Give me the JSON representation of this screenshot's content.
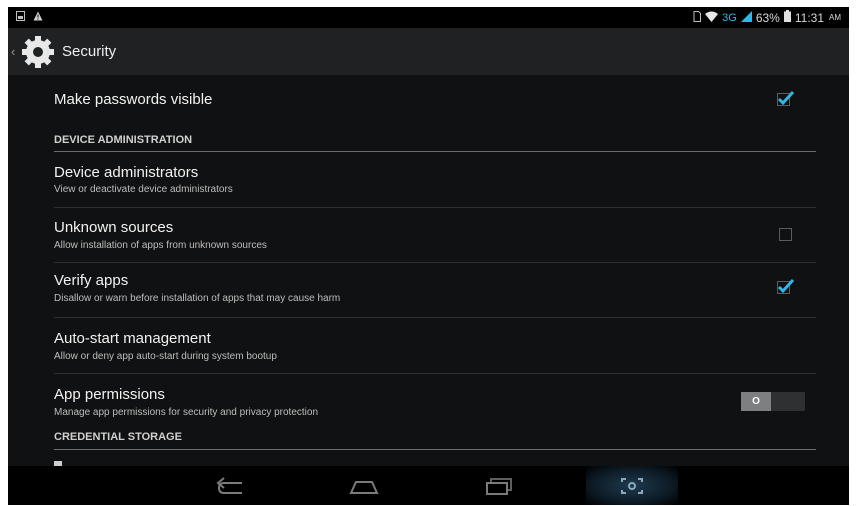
{
  "status_bar": {
    "network": "3G",
    "battery": "63%",
    "time": "11:31",
    "ampm": "AM"
  },
  "action_bar": {
    "title": "Security",
    "icon": "gear-icon"
  },
  "rows": {
    "make_passwords_visible": {
      "title": "Make passwords visible",
      "checked": true
    },
    "device_administrators": {
      "title": "Device administrators",
      "summary": "View or deactivate device administrators"
    },
    "unknown_sources": {
      "title": "Unknown sources",
      "summary": "Allow installation of apps from unknown sources",
      "checked": false
    },
    "verify_apps": {
      "title": "Verify apps",
      "summary": "Disallow or warn before installation of apps that may cause harm",
      "checked": true
    },
    "auto_start": {
      "title": "Auto-start management",
      "summary": "Allow or deny app auto-start during system bootup"
    },
    "app_permissions": {
      "title": "App permissions",
      "summary": "Manage app permissions for security and privacy protection",
      "toggle_label": "O",
      "toggle_on": false
    }
  },
  "sections": {
    "device_administration": "DEVICE ADMINISTRATION",
    "credential_storage": "CREDENTIAL STORAGE"
  },
  "nav_bar": {
    "buttons": [
      "back-icon",
      "home-icon",
      "recent-apps-icon",
      "screenshot-icon"
    ]
  },
  "colors": {
    "accent": "#33b5e5",
    "background": "#101112",
    "action_bar": "#1f2123"
  }
}
